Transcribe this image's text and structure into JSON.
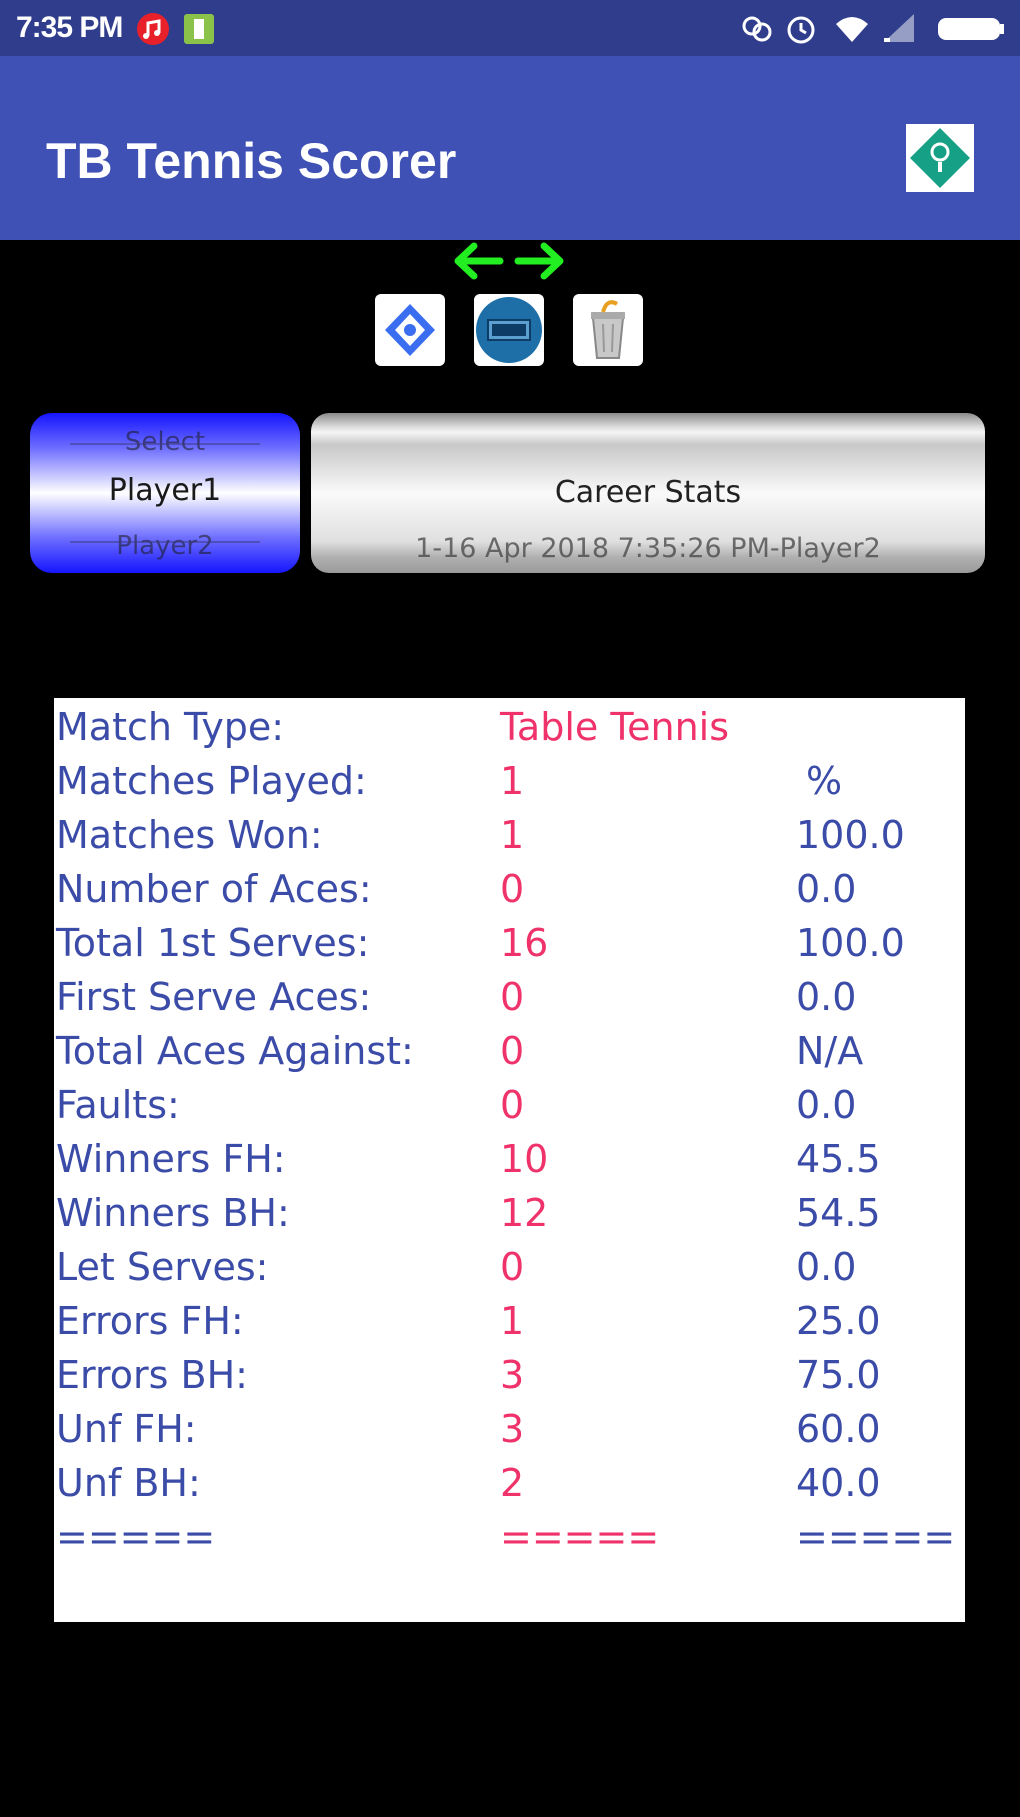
{
  "status_bar": {
    "time": "7:35 PM",
    "icons": [
      "music-notification-icon",
      "battery-saver-icon",
      "link-icon",
      "alarm-icon",
      "wifi-icon",
      "cell-signal-icon",
      "battery-icon"
    ]
  },
  "app_bar": {
    "title": "TB Tennis Scorer",
    "help_icon": "help-diamond-icon"
  },
  "toolbar": {
    "swap_icon": "swap-arrows-icon",
    "buttons": [
      "help-icon",
      "scoreboard-icon",
      "trash-icon"
    ]
  },
  "player_picker": {
    "items": [
      "Select",
      "Player1",
      "Player2"
    ],
    "selected": "Player1"
  },
  "career_stats": {
    "label": "Career Stats",
    "subtitle": "1-16 Apr 2018 7:35:26 PM-Player2"
  },
  "stats": {
    "rows": [
      {
        "label": "Match Type:",
        "value": "Table Tennis",
        "pct": ""
      },
      {
        "label": "Matches Played:",
        "value": "1",
        "pct": "%"
      },
      {
        "label": "Matches Won:",
        "value": "1",
        "pct": "100.0"
      },
      {
        "label": "Number of Aces:",
        "value": "0",
        "pct": "0.0"
      },
      {
        "label": "Total 1st Serves:",
        "value": "16",
        "pct": "100.0"
      },
      {
        "label": "First Serve Aces:",
        "value": "0",
        "pct": "0.0"
      },
      {
        "label": "Total Aces Against:",
        "value": "0",
        "pct": "N/A"
      },
      {
        "label": "Faults:",
        "value": "0",
        "pct": "0.0"
      },
      {
        "label": "Winners FH:",
        "value": "10",
        "pct": "45.5"
      },
      {
        "label": "Winners BH:",
        "value": "12",
        "pct": "54.5"
      },
      {
        "label": "Let Serves:",
        "value": "0",
        "pct": "0.0"
      },
      {
        "label": "Errors FH:",
        "value": "1",
        "pct": "25.0"
      },
      {
        "label": "Errors BH:",
        "value": "3",
        "pct": "75.0"
      },
      {
        "label": "Unf FH:",
        "value": "3",
        "pct": "60.0"
      },
      {
        "label": "Unf BH:",
        "value": "2",
        "pct": "40.0"
      },
      {
        "label": "=====",
        "value": "=====",
        "pct": "====="
      }
    ]
  },
  "colors": {
    "app_bar": "#3f51b5",
    "status_bar": "#2f3d8c",
    "label_text": "#3b4ba8",
    "value_text": "#f0326a"
  }
}
